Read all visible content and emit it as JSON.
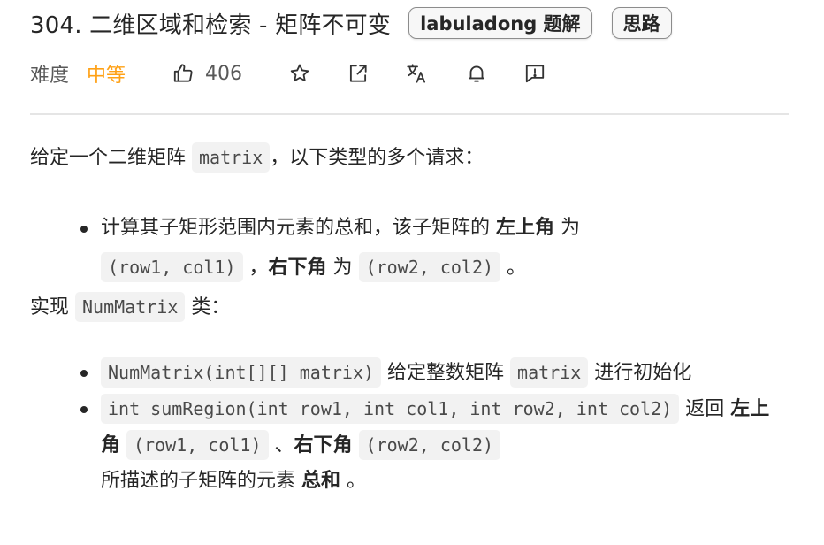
{
  "header": {
    "title": "304. 二维区域和检索 - 矩阵不可变",
    "tags": [
      "labuladong 题解",
      "思路"
    ]
  },
  "meta": {
    "difficulty_label": "难度",
    "difficulty_value": "中等",
    "like_count": "406",
    "icons": [
      "thumbs-up-icon",
      "star-icon",
      "share-icon",
      "translate-icon",
      "bell-icon",
      "feedback-icon"
    ]
  },
  "colors": {
    "difficulty": "#ffa116",
    "code_bg": "#f2f2f2",
    "divider": "#e5e5e5"
  },
  "description": {
    "intro": {
      "pre": "给定一个二维矩阵",
      "code": "matrix",
      "post": "，以下类型的多个请求："
    },
    "req": {
      "pre": "计算其子矩形范围内元素的总和，该子矩阵的",
      "bold1": "左上角",
      "mid1": "为",
      "code1": "(row1, col1)",
      "sep": "，",
      "bold2": "右下角",
      "mid2": "为",
      "code2": "(row2, col2)",
      "end": "。"
    },
    "impl": {
      "pre": "实现",
      "code": "NumMatrix",
      "post": "类："
    },
    "method1": {
      "code": "NumMatrix(int[][] matrix)",
      "text1": "给定整数矩阵",
      "code2": "matrix",
      "text2": "进行初始化"
    },
    "method2": {
      "code1": "int sumRegion(int row1, int col1, int row2, int col2)",
      "text1": "返回",
      "bold1": "左上角",
      "code2": "(row1, col1)",
      "sep": "、",
      "bold2": "右下角",
      "code3": "(row2, col2)",
      "text2": "所描述的子矩阵的元素",
      "bold3": "总和",
      "end": "。"
    }
  }
}
